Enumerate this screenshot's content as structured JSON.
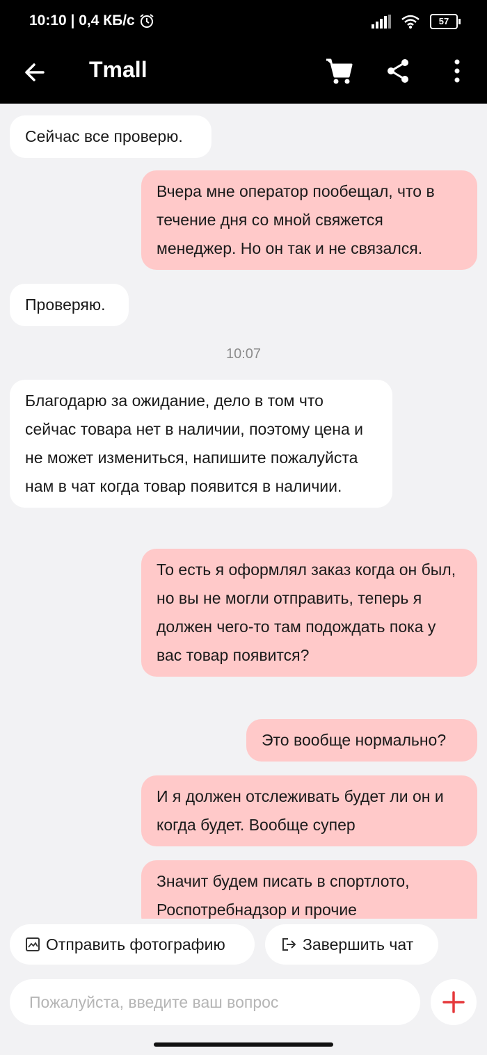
{
  "status": {
    "time_speed": "10:10 | 0,4 КБ/с",
    "battery": "57"
  },
  "appbar": {
    "title": "Tmall"
  },
  "messages": [
    {
      "text": "Сейчас все проверю."
    },
    {
      "text": "Вчера мне оператор пообещал, что в течение дня со мной свяжется менеджер. Но он так и не связался."
    },
    {
      "text": "Проверяю."
    },
    {
      "text": "Благодарю за ожидание, дело в том что сейчас товара нет в наличии, поэтому цена и не может измениться, напишите пожалуйста нам в чат когда товар появится в наличии."
    },
    {
      "text": "То есть я оформлял заказ когда он был, но вы не могли отправить, теперь я должен чего-то там подождать пока у вас товар появится?"
    },
    {
      "text": "Это вообще нормально?"
    },
    {
      "text": "И я должен отслеживать будет ли он и когда будет. Вообще супер"
    },
    {
      "text": "Значит будем писать в спортлото, Роспотребнадзор и прочие"
    }
  ],
  "timestamp": "10:07",
  "quick_actions": {
    "send_photo": "Отправить фотографию",
    "end_chat": "Завершить чат"
  },
  "input": {
    "placeholder": "Пожалуйста, введите ваш вопрос",
    "value": ""
  },
  "colors": {
    "accent": "#e5383b",
    "outgoing_bubble": "#ffc9c9",
    "incoming_bubble": "#ffffff"
  }
}
